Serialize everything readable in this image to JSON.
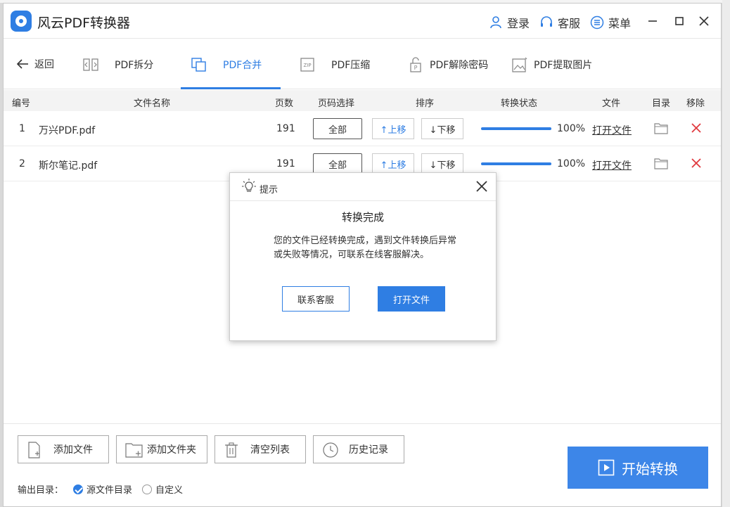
{
  "app": {
    "title": "风云PDF转换器"
  },
  "titlebar": {
    "login": "登录",
    "service": "客服",
    "menu": "菜单"
  },
  "nav": {
    "back": "返回",
    "tabs": [
      {
        "label": "PDF拆分",
        "icon": "split-icon"
      },
      {
        "label": "PDF合并",
        "icon": "merge-icon",
        "active": true
      },
      {
        "label": "PDF压缩",
        "icon": "zip-icon"
      },
      {
        "label": "PDF解除密码",
        "icon": "lock-icon"
      },
      {
        "label": "PDF提取图片",
        "icon": "image-icon"
      }
    ]
  },
  "table": {
    "headers": {
      "index": "编号",
      "name": "文件名称",
      "pages": "页数",
      "page_select": "页码选择",
      "sort": "排序",
      "status": "转换状态",
      "file": "文件",
      "dir": "目录",
      "remove": "移除"
    },
    "rows": [
      {
        "index": "1",
        "name": "万兴PDF.pdf",
        "pages": "191",
        "range": "全部",
        "up": "↑上移",
        "down": "↓下移",
        "progress": 1.0,
        "percent": "100%",
        "open": "打开文件"
      },
      {
        "index": "2",
        "name": "斯尔笔记.pdf",
        "pages": "191",
        "range": "全部",
        "up": "↑上移",
        "down": "↓下移",
        "progress": 1.0,
        "percent": "100%",
        "open": "打开文件"
      }
    ]
  },
  "footer": {
    "add_file": "添加文件",
    "add_folder": "添加文件夹",
    "clear": "清空列表",
    "history": "历史记录",
    "output_label": "输出目录：",
    "opt_source": "源文件目录",
    "opt_custom": "自定义",
    "start": "开始转换"
  },
  "modal": {
    "header": "提示",
    "title": "转换完成",
    "message": "您的文件已经转换完成，遇到文件转换后异常或失败等情况，可联系在线客服解决。",
    "contact": "联系客服",
    "open": "打开文件"
  },
  "colors": {
    "accent": "#2f7ee3",
    "remove": "#e0393e"
  }
}
